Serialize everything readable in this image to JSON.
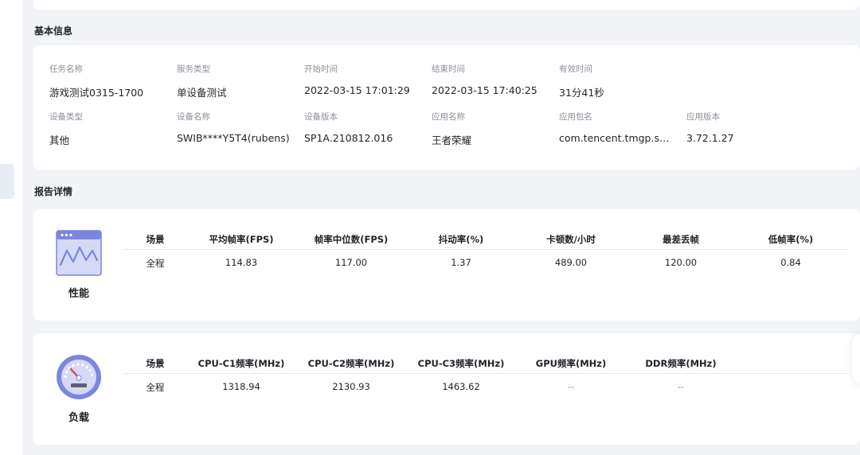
{
  "sections": {
    "basic_info_title": "基本信息",
    "report_detail_title": "报告详情"
  },
  "basic_info": {
    "task_name_label": "任务名称",
    "task_name": "游戏测试0315-1700",
    "service_type_label": "服务类型",
    "service_type": "单设备测试",
    "start_time_label": "开始时间",
    "start_time": "2022-03-15 17:01:29",
    "end_time_label": "结束时间",
    "end_time": "2022-03-15 17:40:25",
    "valid_time_label": "有效时间",
    "valid_time": "31分41秒",
    "device_type_label": "设备类型",
    "device_type": "其他",
    "device_name_label": "设备名称",
    "device_name": "SWIB****Y5T4(rubens)",
    "device_version_label": "设备版本",
    "device_version": "SP1A.210812.016",
    "app_name_label": "应用名称",
    "app_name": "王者荣耀",
    "app_package_label": "应用包名",
    "app_package": "com.tencent.tmgp.sgame",
    "app_version_label": "应用版本",
    "app_version": "3.72.1.27"
  },
  "performance": {
    "name": "性能",
    "headers": [
      "场景",
      "平均帧率(FPS)",
      "帧率中位数(FPS)",
      "抖动率(%)",
      "卡顿数/小时",
      "最差丢帧",
      "低帧率(%)"
    ],
    "row": [
      "全程",
      "114.83",
      "117.00",
      "1.37",
      "489.00",
      "120.00",
      "0.84"
    ]
  },
  "load": {
    "name": "负载",
    "headers": [
      "场景",
      "CPU-C1频率(MHz)",
      "CPU-C2频率(MHz)",
      "CPU-C3频率(MHz)",
      "GPU频率(MHz)",
      "DDR频率(MHz)"
    ],
    "row": [
      "全程",
      "1318.94",
      "2130.93",
      "1463.62",
      "--",
      "--"
    ]
  },
  "colors": {
    "accent": "#7b86e0",
    "accent_light": "#d5d9f6",
    "page_bg": "#f2f4f7"
  }
}
